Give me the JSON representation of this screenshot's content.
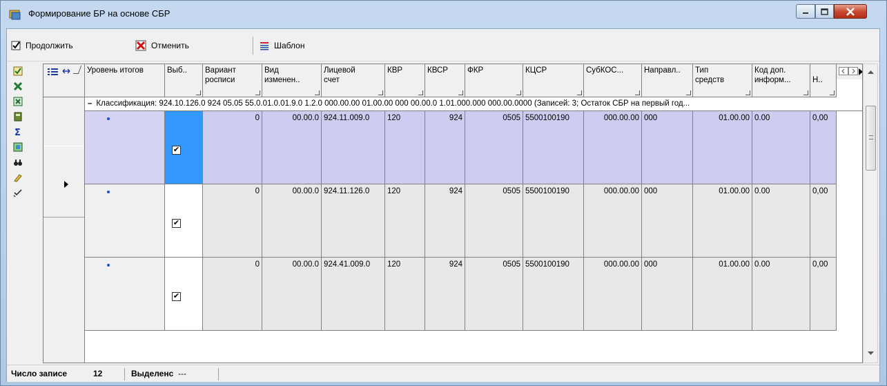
{
  "window": {
    "title": "Формирование БР на основе СБР"
  },
  "toolbar": {
    "continue_label": "Продолжить",
    "cancel_label": "Отменить",
    "template_label": "Шаблон"
  },
  "sidebar": {
    "icons": [
      "checklist-icon",
      "excel-export-icon",
      "excel-icon",
      "calculator-icon",
      "sigma-icon",
      "refresh-icon",
      "binoculars-icon",
      "eraser-icon",
      "check-mark-icon"
    ]
  },
  "grid": {
    "columns": [
      {
        "key": "level",
        "label": "Уровень итогов"
      },
      {
        "key": "sel",
        "label": "Выб.."
      },
      {
        "key": "variant",
        "label": "Вариант\nросписи"
      },
      {
        "key": "vid",
        "label": "Вид\nизменен.."
      },
      {
        "key": "account",
        "label": "Лицевой\nсчет"
      },
      {
        "key": "kvr",
        "label": "КВР"
      },
      {
        "key": "kvsr",
        "label": "КВСР"
      },
      {
        "key": "fkr",
        "label": "ФКР"
      },
      {
        "key": "kcsr",
        "label": "КЦСР"
      },
      {
        "key": "subkosgu",
        "label": "СубКОС..."
      },
      {
        "key": "naprav",
        "label": "Направл.."
      },
      {
        "key": "tip",
        "label": "Тип\nсредств"
      },
      {
        "key": "koddop",
        "label": "Код доп.\nинформ..."
      },
      {
        "key": "n",
        "label": "\nН.."
      }
    ],
    "group_text": "Классификация: 924.10.126.0 924 05.05 55.0.01.0.01.9.0 1.2.0 000.00.00 01.00.00 000 00.00.0 1.01.000.000 000.00.0000 (Записей: 3; Остаток СБР на первый год...",
    "rows": [
      {
        "variant": "0",
        "vid": "00.00.0",
        "account": "924.11.009.0",
        "kvr": "120",
        "kvsr": "924",
        "fkr": "0505",
        "kcsr": "5500100190",
        "subkosgu": "000.00.00",
        "naprav": "000",
        "tip": "01.00.00",
        "koddop": "0.00",
        "n": "0,00",
        "checked": true
      },
      {
        "variant": "0",
        "vid": "00.00.0",
        "account": "924.11.126.0",
        "kvr": "120",
        "kvsr": "924",
        "fkr": "0505",
        "kcsr": "5500100190",
        "subkosgu": "000.00.00",
        "naprav": "000",
        "tip": "01.00.00",
        "koddop": "0.00",
        "n": "0,00",
        "checked": true
      },
      {
        "variant": "0",
        "vid": "00.00.0",
        "account": "924.41.009.0",
        "kvr": "120",
        "kvsr": "924",
        "fkr": "0505",
        "kcsr": "5500100190",
        "subkosgu": "000.00.00",
        "naprav": "000",
        "tip": "01.00.00",
        "koddop": "0.00",
        "n": "0,00",
        "checked": true
      }
    ]
  },
  "status": {
    "count_label": "Число записе",
    "count_value": "12",
    "selected_label": "Выделенс",
    "selected_value": "---"
  },
  "colors": {
    "selected_row": "#cccdf0",
    "selected_cell": "#3399ff",
    "unselected_row": "#e8e8e8"
  }
}
